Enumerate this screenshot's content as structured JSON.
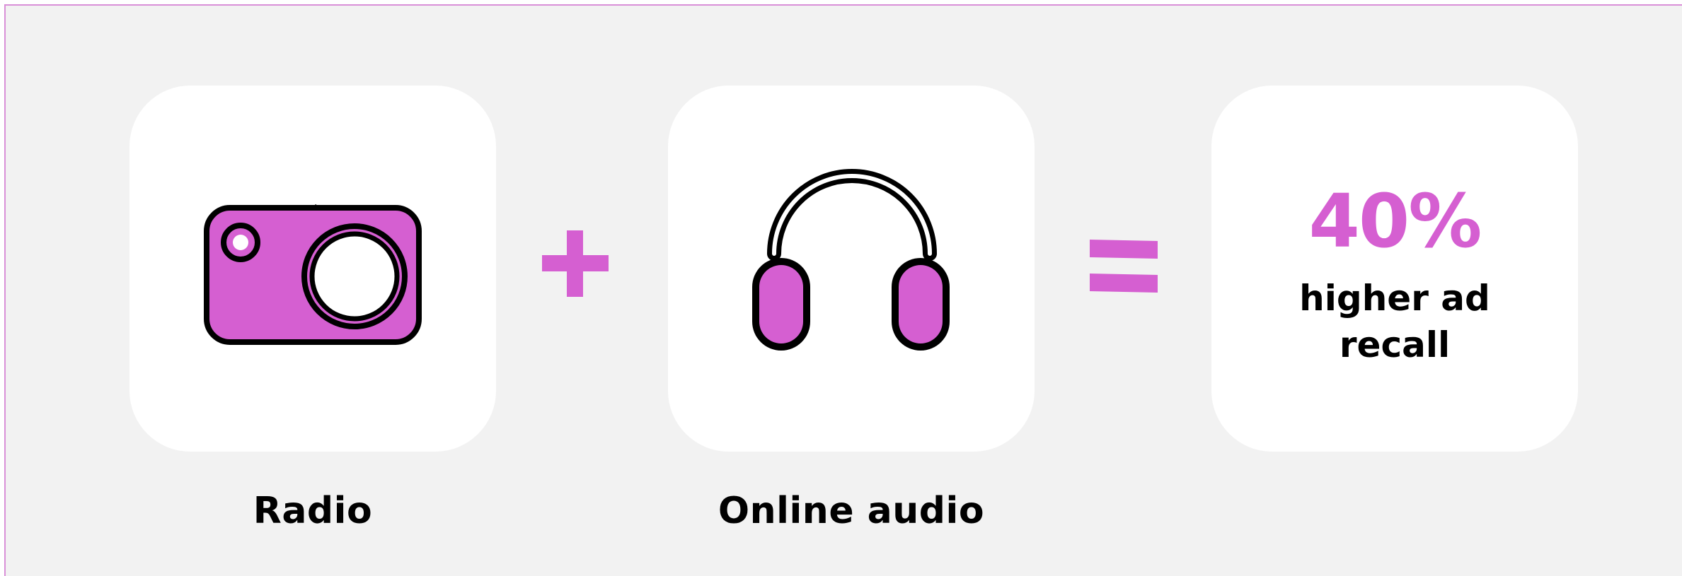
{
  "colors": {
    "accent": "#d55fd1",
    "background": "#f2f2f2",
    "card": "#ffffff",
    "ink": "#000000"
  },
  "items": [
    {
      "label": "Radio",
      "icon": "radio-icon"
    },
    {
      "label": "Online audio",
      "icon": "headphones-icon"
    }
  ],
  "operators": {
    "plus": "plus-icon",
    "equals": "equals-icon"
  },
  "result": {
    "value": "40%",
    "caption": "higher ad recall"
  }
}
